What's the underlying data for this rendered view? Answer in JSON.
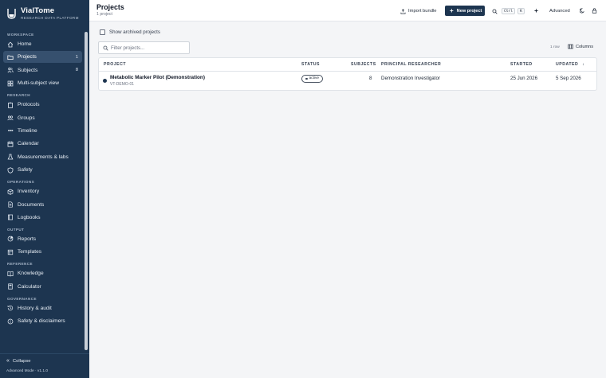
{
  "app": {
    "name": "VialTome",
    "subtitle": "RESEARCH DATA PLATFORM"
  },
  "sidebar": {
    "sections": [
      {
        "title": "WORKSPACE",
        "items": [
          {
            "label": "Home",
            "icon": "home-icon"
          },
          {
            "label": "Projects",
            "icon": "folder-icon",
            "count": "1",
            "active": true
          },
          {
            "label": "Subjects",
            "icon": "users-icon",
            "count": "8"
          },
          {
            "label": "Multi-subject view",
            "icon": "grid-icon"
          }
        ]
      },
      {
        "title": "RESEARCH",
        "items": [
          {
            "label": "Protocols",
            "icon": "clipboard-icon"
          },
          {
            "label": "Groups",
            "icon": "group-icon"
          },
          {
            "label": "Timeline",
            "icon": "timeline-icon"
          },
          {
            "label": "Calendar",
            "icon": "calendar-icon"
          },
          {
            "label": "Measurements & labs",
            "icon": "flask-icon"
          },
          {
            "label": "Safety",
            "icon": "shield-icon"
          }
        ]
      },
      {
        "title": "OPERATIONS",
        "items": [
          {
            "label": "Inventory",
            "icon": "box-icon"
          },
          {
            "label": "Documents",
            "icon": "document-icon"
          },
          {
            "label": "Logbooks",
            "icon": "book-icon"
          }
        ]
      },
      {
        "title": "OUTPUT",
        "items": [
          {
            "label": "Reports",
            "icon": "report-icon"
          },
          {
            "label": "Templates",
            "icon": "template-icon"
          }
        ]
      },
      {
        "title": "REFERENCE",
        "items": [
          {
            "label": "Knowledge",
            "icon": "knowledge-icon"
          },
          {
            "label": "Calculator",
            "icon": "calculator-icon"
          }
        ]
      },
      {
        "title": "GOVERNANCE",
        "items": [
          {
            "label": "History & audit",
            "icon": "history-icon"
          },
          {
            "label": "Safety & disclaimers",
            "icon": "info-icon"
          }
        ]
      }
    ],
    "collapse_label": "Collapse",
    "mode_label": "Advanced Mode · v1.1.0"
  },
  "header": {
    "title": "Projects",
    "subtitle": "1 project",
    "import_label": "Import bundle",
    "new_project_label": "New project",
    "shortcut_ctrl": "Ctrl",
    "shortcut_key": "K",
    "advanced_label": "Advanced"
  },
  "filters": {
    "show_archived_label": "Show archived projects",
    "show_archived_checked": false,
    "search_placeholder": "Filter projects...",
    "row_count": "1 row",
    "columns_label": "Columns"
  },
  "table": {
    "columns": [
      "PROJECT",
      "STATUS",
      "SUBJECTS",
      "PRINCIPAL RESEARCHER",
      "STARTED",
      "UPDATED"
    ],
    "sort_indicator": "↓",
    "rows": [
      {
        "name": "Metabolic Marker Pilot (Demonstration)",
        "code": "VT-DEMO-01",
        "status": "active",
        "subjects": "8",
        "researcher": "Demonstration Investigator",
        "started": "25 Jun 2026",
        "updated": "5 Sep 2026"
      }
    ]
  },
  "colors": {
    "sidebar_bg": "#1d3550",
    "accent": "#1d3550",
    "active_item": "#36506e"
  }
}
